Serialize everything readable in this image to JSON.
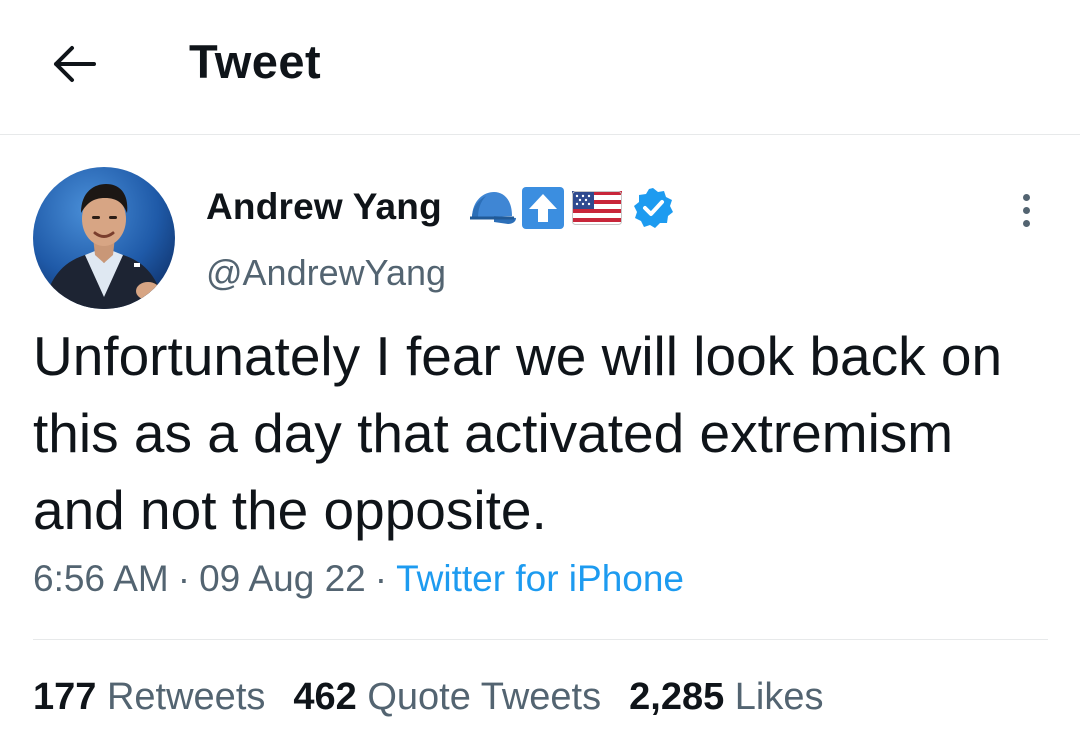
{
  "header": {
    "title": "Tweet",
    "back_icon": "arrow-left-icon"
  },
  "tweet": {
    "author": {
      "name": "Andrew Yang",
      "name_emojis": [
        "cap-emoji",
        "up-arrow-emoji",
        "us-flag-emoji"
      ],
      "verified_icon": "verified-badge-icon",
      "handle": "@AndrewYang"
    },
    "text": "Unfortunately I fear we will look back on this as a day that activated extremism and not the opposite.",
    "time": "6:56 AM",
    "date": "09 Aug 22",
    "separator": "·",
    "source": "Twitter for iPhone"
  },
  "stats": {
    "retweets_count": "177",
    "retweets_label": "Retweets",
    "quotes_count": "462",
    "quotes_label": "Quote Tweets",
    "likes_count": "2,285",
    "likes_label": "Likes"
  },
  "colors": {
    "accent": "#1d9bf0",
    "text_primary": "#0f1419",
    "text_secondary": "#536471",
    "divider": "#e7e9ea"
  }
}
